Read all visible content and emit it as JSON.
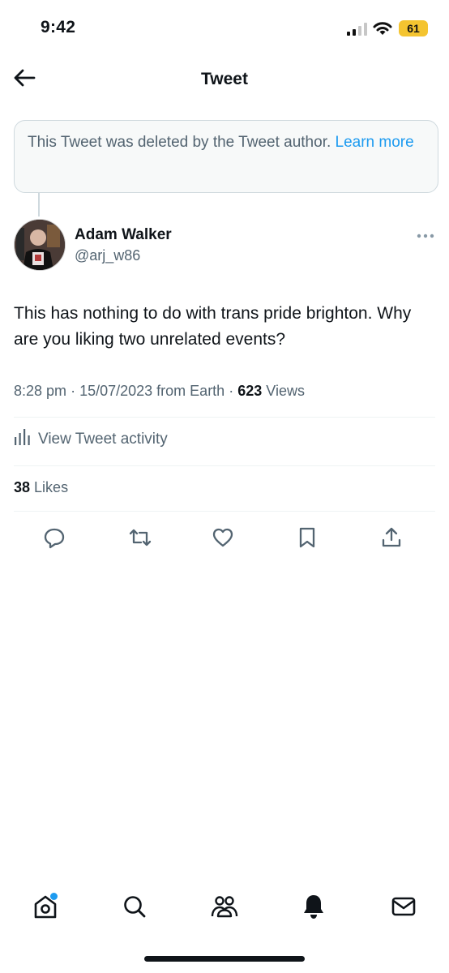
{
  "status_bar": {
    "time": "9:42",
    "battery": "61"
  },
  "header": {
    "title": "Tweet"
  },
  "deleted_notice": {
    "text": "This Tweet was deleted by the Tweet author.",
    "link": "Learn more"
  },
  "author": {
    "name": "Adam Walker",
    "handle": "@arj_w86"
  },
  "tweet": {
    "text": "This has nothing to do with trans pride brighton. Why are you liking two unrelated events?",
    "time": "8:28 pm",
    "date": "15/07/2023",
    "source": "from Earth",
    "views_count": "623",
    "views_label": "Views"
  },
  "activity": {
    "label": "View Tweet activity"
  },
  "likes": {
    "count": "38",
    "label": "Likes"
  },
  "actions": [
    "reply-icon",
    "retweet-icon",
    "like-icon",
    "bookmark-icon",
    "share-icon"
  ],
  "bottom_nav": [
    "home-icon",
    "search-icon",
    "communities-icon",
    "notifications-icon",
    "messages-icon"
  ],
  "colors": {
    "accent": "#1d9bf0",
    "muted": "#536471",
    "text": "#0f1419",
    "battery": "#f4c430"
  }
}
